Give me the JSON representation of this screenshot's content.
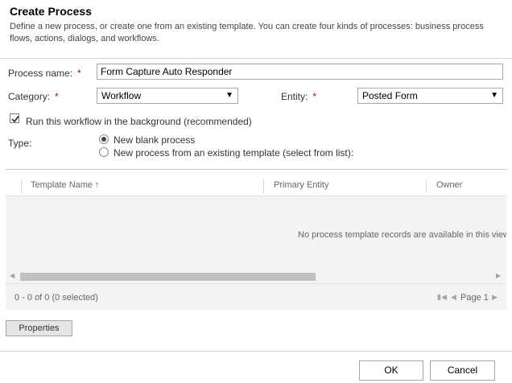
{
  "dialog": {
    "title": "Create Process",
    "description": "Define a new process, or create one from an existing template. You can create four kinds of processes: business process flows, actions, dialogs, and workflows."
  },
  "form": {
    "process_name_label": "Process name:",
    "process_name_value": "Form Capture Auto Responder",
    "required_marker": "*",
    "category_label": "Category:",
    "category_value": "Workflow",
    "entity_label": "Entity:",
    "entity_value": "Posted Form",
    "background_label": "Run this workflow in the background (recommended)",
    "background_checked": true,
    "type_label": "Type:",
    "type_options": [
      {
        "label": "New blank process",
        "selected": true
      },
      {
        "label": "New process from an existing template (select from list):",
        "selected": false
      }
    ]
  },
  "grid": {
    "columns": [
      "Template Name ↑",
      "Primary Entity",
      "Owner"
    ],
    "empty_message": "No process template records are available in this view.",
    "record_count": "0 - 0 of 0 (0 selected)",
    "page_label": "Page 1"
  },
  "buttons": {
    "properties": "Properties",
    "ok": "OK",
    "cancel": "Cancel"
  },
  "colors": {
    "required": "#c00000",
    "grid_background": "#f3f3f3"
  }
}
